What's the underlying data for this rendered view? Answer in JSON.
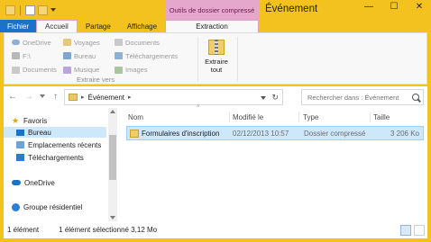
{
  "title_bar": {
    "window_title": "Événement",
    "context_group": "Outils de dossier compressé",
    "buttons": {
      "minimize": "—",
      "maximize": "☐",
      "close": "✕"
    }
  },
  "ribbon_tabs": {
    "file": "Fichier",
    "home": "Accueil",
    "share": "Partage",
    "view": "Affichage",
    "extract": "Extraction"
  },
  "ribbon": {
    "extract_to_items": [
      {
        "label": "OneDrive",
        "icon": "onedrive-icon"
      },
      {
        "label": "Voyages",
        "icon": "folder-icon"
      },
      {
        "label": "Documents",
        "icon": "documents-icon"
      },
      {
        "label": "F:\\",
        "icon": "drive-icon"
      },
      {
        "label": "Bureau",
        "icon": "desktop-icon"
      },
      {
        "label": "Téléchargements",
        "icon": "downloads-icon"
      },
      {
        "label": "Documents",
        "icon": "documents-icon"
      },
      {
        "label": "Musique",
        "icon": "music-icon"
      },
      {
        "label": "Images",
        "icon": "pictures-icon"
      }
    ],
    "group_label": "Extraire vers",
    "extract_all": "Extraire tout"
  },
  "address": {
    "crumb": "Événement",
    "search_placeholder": "Rechercher dans : Événement"
  },
  "navigation": {
    "favorites": "Favoris",
    "items": [
      "Bureau",
      "Emplacements récents",
      "Téléchargements"
    ],
    "onedrive": "OneDrive",
    "homegroup": "Groupe résidentiel"
  },
  "file_list": {
    "columns": {
      "name": "Nom",
      "modified": "Modifié le",
      "type": "Type",
      "size": "Taille"
    },
    "rows": [
      {
        "name": "Formulaires d'inscription",
        "modified": "02/12/2013 10:57",
        "type": "Dossier compressé",
        "size": "3 206 Ko"
      }
    ]
  },
  "status_bar": {
    "count": "1 élément",
    "selected": "1 élément sélectionné  3,12 Mo"
  },
  "colors": {
    "frame": "#f3c21f",
    "file_tab": "#1b73c8",
    "context_tab": "#e6a7cd",
    "selection": "#cde8fb"
  }
}
